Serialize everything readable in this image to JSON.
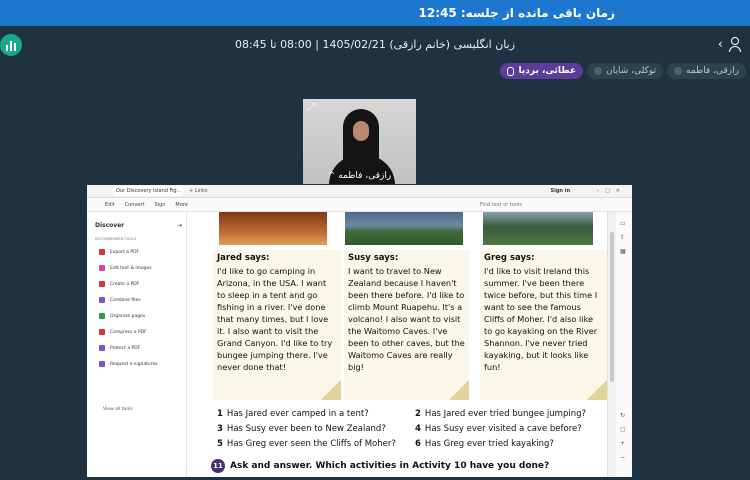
{
  "timer": {
    "label": "زمان باقی مانده از جلسه: 12:45"
  },
  "session": {
    "info": "زبان انگلیسی (خانم رازقی) 1405/02/21 | 08:00 تا 08:45"
  },
  "participants": [
    {
      "name": "رازقی، فاطمه",
      "active": false
    },
    {
      "name": "توکلی، شایان",
      "active": false
    },
    {
      "name": "عطائی، بردیا",
      "active": true
    }
  ],
  "video": {
    "name": "رازقی، فاطمه",
    "caret": "^"
  },
  "browser": {
    "tab_title": "Our Discovery Island Fig...",
    "new_tab": "+ Links",
    "sign_in": "Sign in",
    "toolbar": [
      "Edit",
      "Convert",
      "Sign",
      "More"
    ],
    "find": "Find text or tools"
  },
  "sidebar": {
    "title": "Discover",
    "recommended": "RECOMMENDED TOOLS",
    "items": [
      "Export a PDF",
      "Edit text & images",
      "Create a PDF",
      "Combine files",
      "Organize pages",
      "Compress a PDF",
      "Protect a PDF",
      "Request e-signatures"
    ],
    "view_all": "View all tools"
  },
  "notes": [
    {
      "who": "Jared says:",
      "text": "I'd like to go camping in Arizona, in the USA. I want to sleep in a tent and go fishing in a river. I've done that many times, but I love it. I also want to visit the Grand Canyon. I'd like to try bungee jumping there. I've never done that!"
    },
    {
      "who": "Susy says:",
      "text": "I want to travel to New Zealand because I haven't been there before. I'd like to climb Mount Ruapehu. It's a volcano! I also want to visit the Waitomo Caves. I've been to other caves, but the Waitomo Caves are really big!"
    },
    {
      "who": "Greg says:",
      "text": "I'd like to visit Ireland this summer. I've been there twice before, but this time I want to see the famous Cliffs of Moher. I'd also like to go kayaking on the River Shannon. I've never tried kayaking, but it looks like fun!"
    }
  ],
  "questions": [
    {
      "n": "1",
      "text": "Has Jared ever camped in a tent?"
    },
    {
      "n": "2",
      "text": "Has Jared ever tried bungee jumping?"
    },
    {
      "n": "3",
      "text": "Has Susy ever been to New Zealand?"
    },
    {
      "n": "4",
      "text": "Has Susy ever visited a cave before?"
    },
    {
      "n": "5",
      "text": "Has Greg ever seen the Cliffs of Moher?"
    },
    {
      "n": "6",
      "text": "Has Greg ever tried kayaking?"
    }
  ],
  "activity": {
    "num": "11",
    "text": "Ask and answer. Which activities in Activity 10 have you done?"
  },
  "colors": {
    "timer_bar": "#1d77cf",
    "background": "#1e3241",
    "active_chip": "#5b3c9b",
    "stats_button": "#19a78e"
  }
}
